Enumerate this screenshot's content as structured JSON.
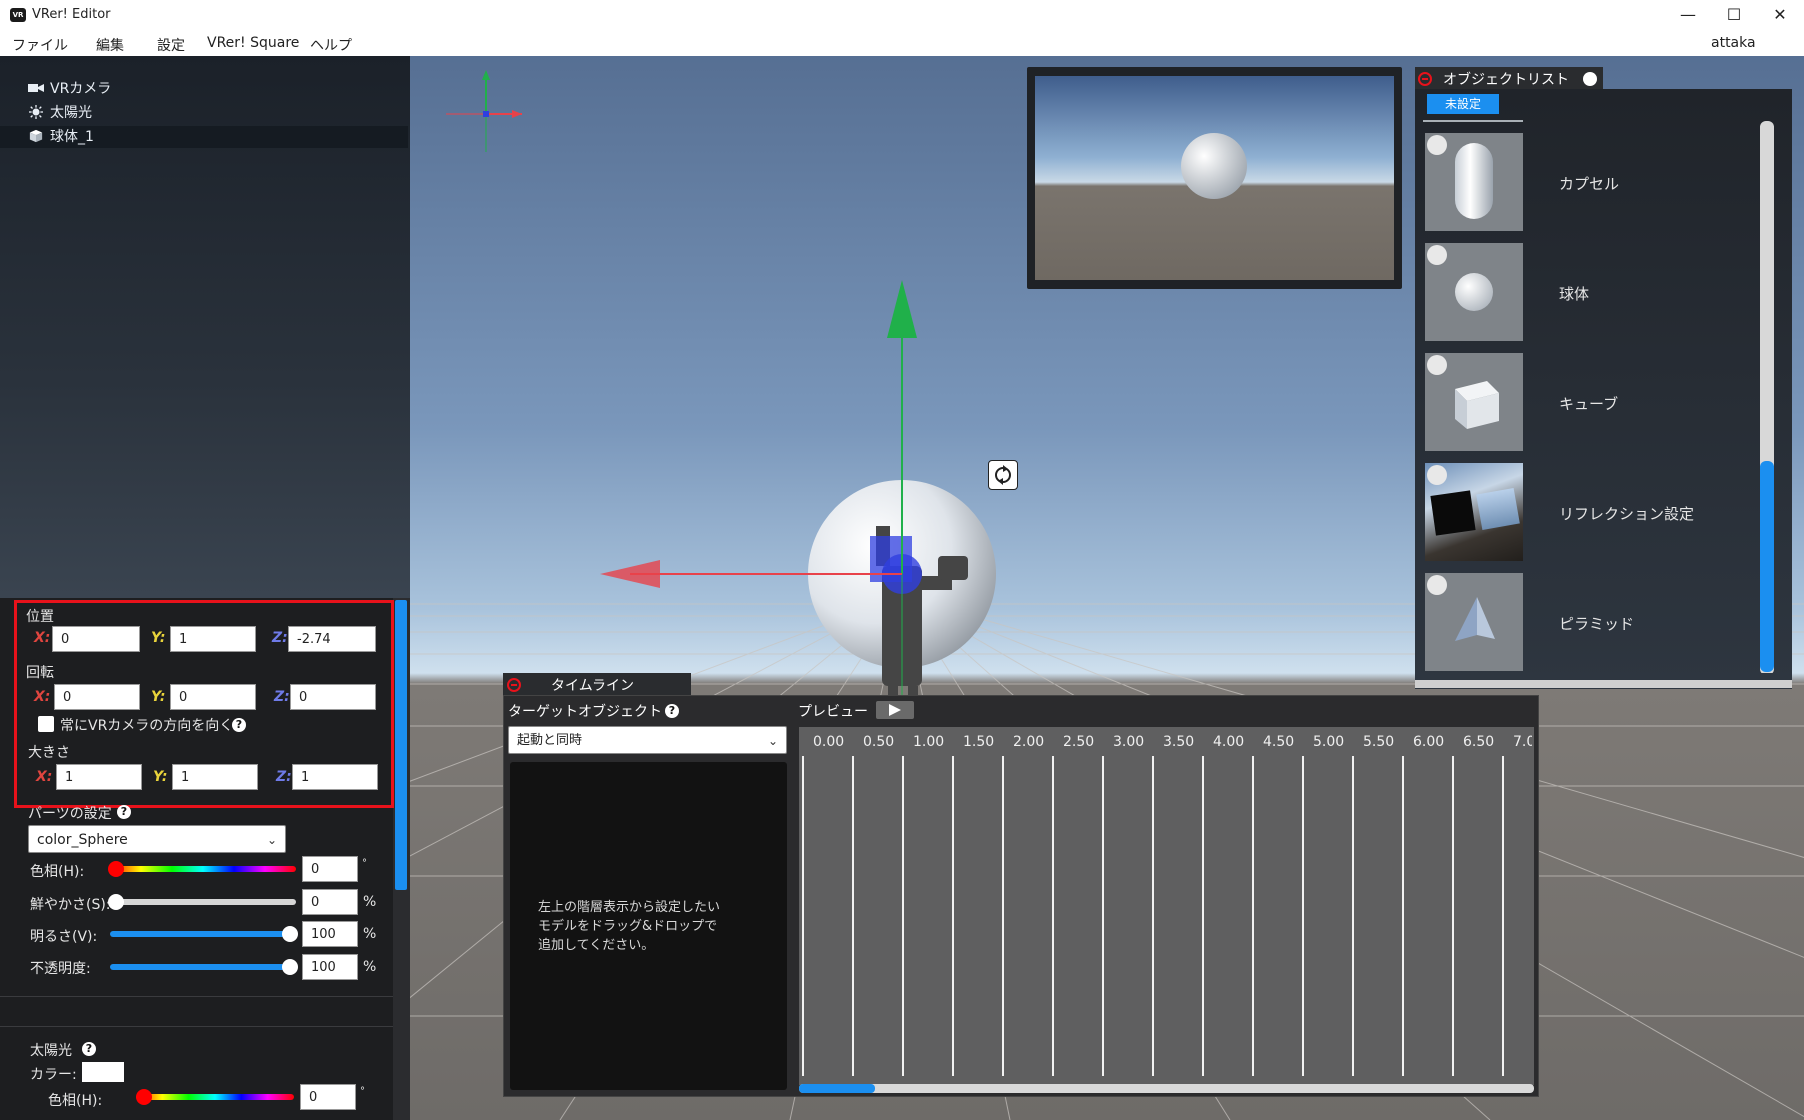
{
  "window": {
    "title": "VRer! Editor",
    "icon_text": "VR",
    "minimize": "—",
    "maximize": "☐",
    "close": "✕"
  },
  "menu": {
    "items": [
      "ファイル",
      "編集",
      "設定",
      "VRer! Square",
      "ヘルプ"
    ],
    "user": "attaka"
  },
  "hierarchy": {
    "items": [
      {
        "label": "VRカメラ",
        "icon": "video-camera-icon"
      },
      {
        "label": "太陽光",
        "icon": "sun-icon"
      },
      {
        "label": "球体_1",
        "icon": "cube-icon",
        "selected": true
      }
    ]
  },
  "inspector": {
    "position": {
      "label": "位置",
      "x": "0",
      "y": "1",
      "z": "-2.74"
    },
    "rotation": {
      "label": "回転",
      "x": "0",
      "y": "0",
      "z": "0"
    },
    "face_camera": {
      "label": "常にVRカメラの方向を向く",
      "checked": false
    },
    "scale": {
      "label": "大きさ",
      "x": "1",
      "y": "1",
      "z": "1"
    },
    "axis": {
      "x": "X:",
      "y": "Y:",
      "z": "Z:"
    },
    "help_glyph": "?",
    "parts": {
      "label": "パーツの設定",
      "selected": "color_Sphere"
    },
    "hue": {
      "label": "色相(H):",
      "value": "0",
      "unit": "°",
      "level": 0.0
    },
    "saturation": {
      "label": "鮮やかさ(S):",
      "value": "0",
      "unit": "%",
      "level": 0.0
    },
    "brightness": {
      "label": "明るさ(V):",
      "value": "100",
      "unit": "%",
      "level": 1.0
    },
    "opacity": {
      "label": "不透明度:",
      "value": "100",
      "unit": "%",
      "level": 1.0
    },
    "sunlight": {
      "label": "太陽光",
      "color_label": "カラー:",
      "color_value": "#ffffff",
      "hue_label": "色相(H):",
      "hue_value": "0",
      "hue_unit": "°"
    }
  },
  "object_list": {
    "title": "オブジェクトリスト",
    "filter_tab": "未設定",
    "items": [
      {
        "label": "カプセル",
        "icon": "capsule-thumbnail"
      },
      {
        "label": "球体",
        "icon": "sphere-thumbnail"
      },
      {
        "label": "キューブ",
        "icon": "cube-thumbnail"
      },
      {
        "label": "リフレクション設定",
        "icon": "reflection-thumbnail"
      },
      {
        "label": "ピラミッド",
        "icon": "pyramid-thumbnail"
      }
    ],
    "scroll_level": 0.45
  },
  "timeline": {
    "title": "タイムライン",
    "target_label": "ターゲットオブジェクト",
    "preview_label": "プレビュー",
    "trigger": "起動と同時",
    "drop_hint": [
      "左上の階層表示から設定したい",
      "モデルをドラッグ&ドロップで",
      "追加してください。"
    ],
    "ticks": [
      "0.00",
      "0.50",
      "1.00",
      "1.50",
      "2.00",
      "2.50",
      "3.00",
      "3.50",
      "4.00",
      "4.50",
      "5.00",
      "5.50",
      "6.00",
      "6.50",
      "7.0"
    ]
  },
  "colors": {
    "accent": "#1b8ff0",
    "highlight_border": "#e8121b",
    "gizmo_x": "#e8424a",
    "gizmo_y": "#20b04a",
    "gizmo_z": "#2f3fe0"
  }
}
